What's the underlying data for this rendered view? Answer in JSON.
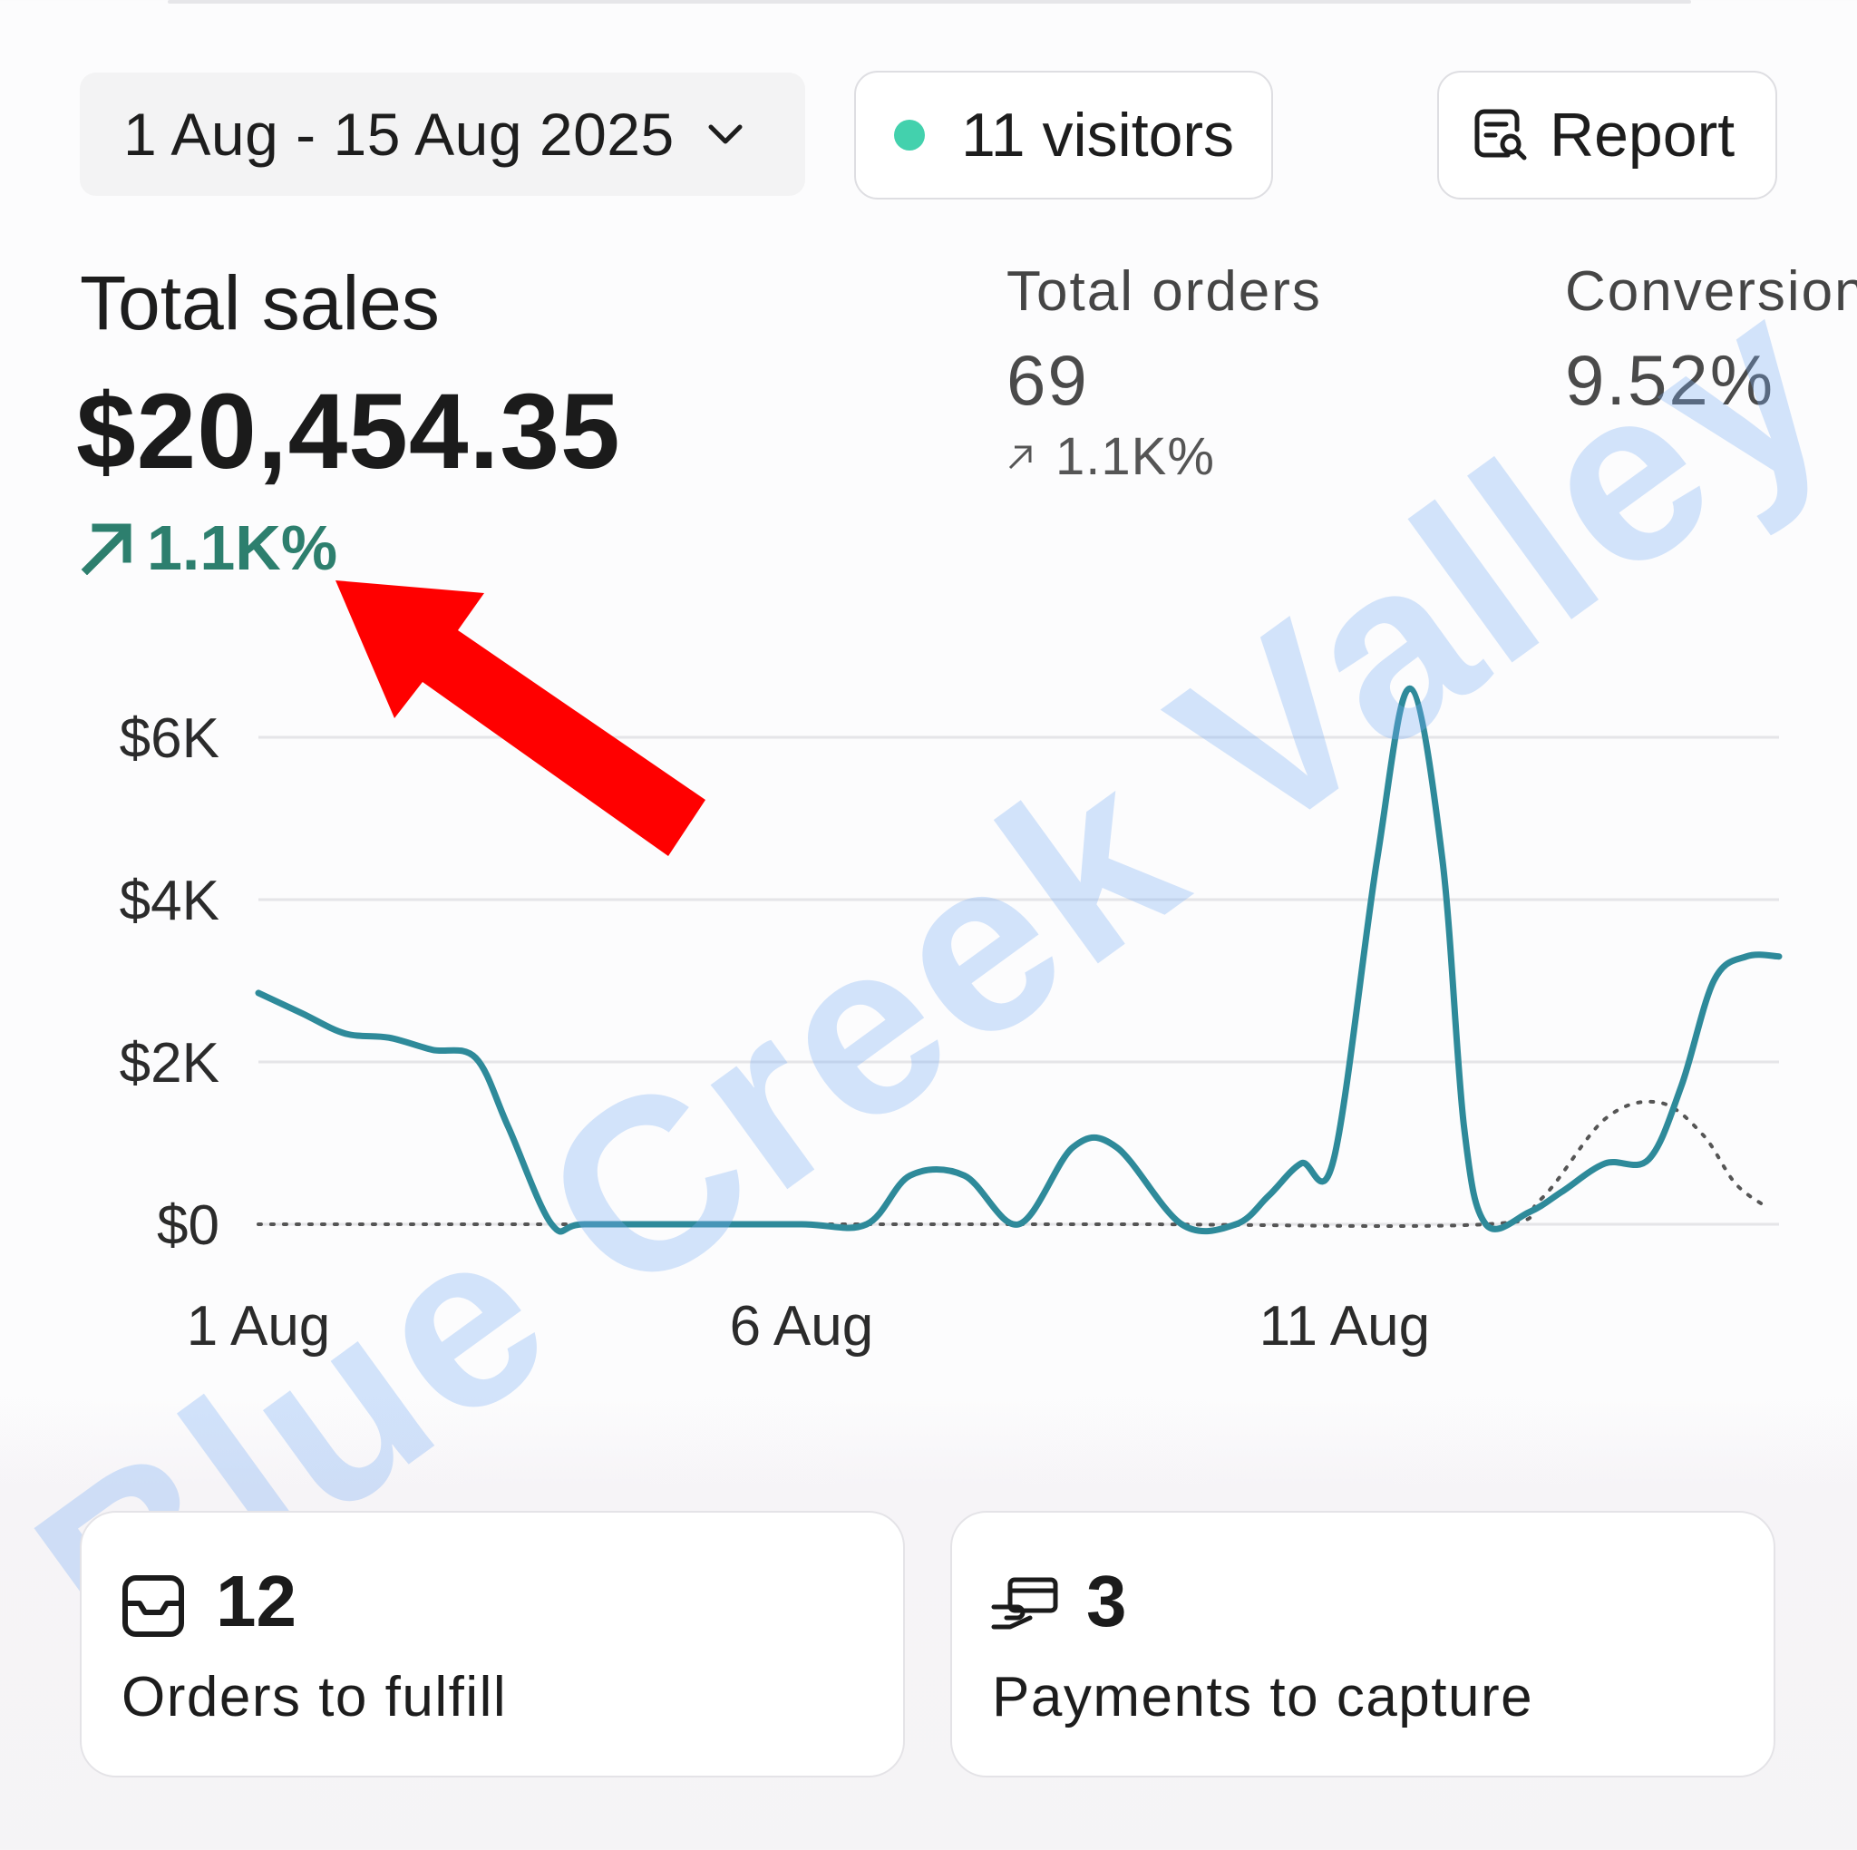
{
  "header": {
    "date_range": "1 Aug - 15 Aug 2025",
    "visitors_label": "11 visitors",
    "report_label": "Report"
  },
  "kpis": {
    "total_sales": {
      "title": "Total sales",
      "value": "$20,454.35",
      "change": "1.1K%"
    },
    "total_orders": {
      "title": "Total orders",
      "value": "69",
      "change": "1.1K%"
    },
    "conversion": {
      "title": "Conversion",
      "value": "9.52%"
    }
  },
  "chart_data": {
    "type": "line",
    "y_ticks": [
      "$6K",
      "$4K",
      "$2K",
      "$0"
    ],
    "x_ticks": [
      "1 Aug",
      "6 Aug",
      "11 Aug"
    ],
    "ylim": [
      0,
      6000
    ],
    "series": [
      {
        "style": "solid",
        "color": "#2e8a9a",
        "x": [
          0,
          0.4,
          0.8,
          1.2,
          1.6,
          2.0,
          2.3,
          2.7,
          3.0,
          4.0,
          5.0,
          5.6,
          6.0,
          6.5,
          7.0,
          7.5,
          7.9,
          8.5,
          9.0,
          9.3,
          9.6,
          9.9,
          10.3,
          10.6,
          10.9,
          11.1,
          11.3,
          11.7,
          12.0,
          12.4,
          12.8,
          13.1,
          13.4,
          13.7,
          14.0
        ],
        "values": [
          2850,
          2600,
          2350,
          2300,
          2150,
          2050,
          1200,
          0,
          0,
          0,
          0,
          0,
          600,
          600,
          0,
          950,
          950,
          0,
          0,
          350,
          750,
          800,
          4500,
          6600,
          4500,
          1200,
          0,
          150,
          400,
          750,
          800,
          1700,
          3000,
          3300,
          3300
        ]
      },
      {
        "style": "dotted",
        "color": "#555555",
        "x": [
          0,
          2.7,
          5.4,
          8.1,
          11.3,
          11.8,
          12.4,
          12.9,
          13.3,
          13.6,
          13.9
        ],
        "values": [
          0,
          0,
          0,
          0,
          0,
          300,
          1300,
          1500,
          1100,
          500,
          200
        ]
      }
    ]
  },
  "cards": [
    {
      "count": "12",
      "caption": "Orders to fulfill",
      "icon": "inbox-icon"
    },
    {
      "count": "3",
      "caption": "Payments to capture",
      "icon": "card-hand-icon"
    }
  ],
  "watermark": "Blue Creek Valley",
  "colors": {
    "line": "#2e8a9a",
    "positive": "#2d7f6e",
    "visitor_dot": "#43d1ad",
    "annotation_arrow": "#ff0000"
  }
}
